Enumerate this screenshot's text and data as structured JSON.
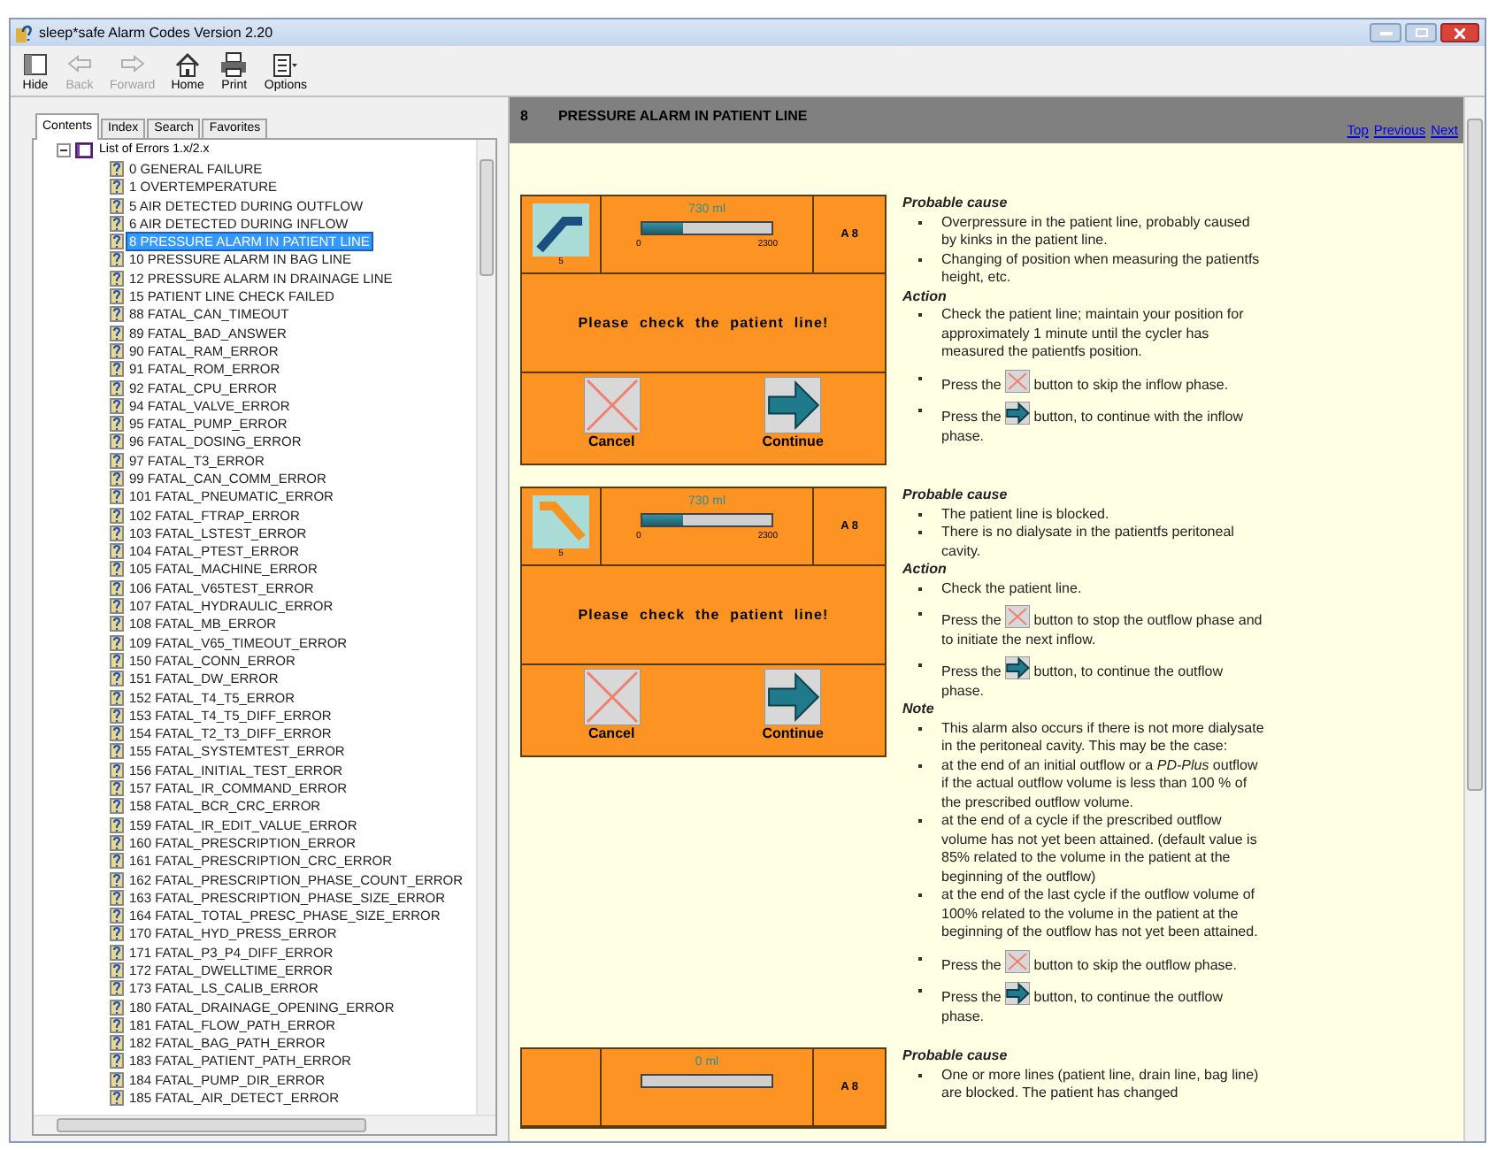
{
  "window": {
    "title": "sleep*safe Alarm Codes Version 2.20"
  },
  "toolbar": [
    {
      "label": "Hide",
      "disabled": false
    },
    {
      "label": "Back",
      "disabled": true
    },
    {
      "label": "Forward",
      "disabled": true
    },
    {
      "label": "Home",
      "disabled": false
    },
    {
      "label": "Print",
      "disabled": false
    },
    {
      "label": "Options",
      "disabled": false
    }
  ],
  "tabs": [
    {
      "label": "Contents",
      "selected": true
    },
    {
      "label": "Index",
      "selected": false
    },
    {
      "label": "Search",
      "selected": false
    },
    {
      "label": "Favorites",
      "selected": false
    }
  ],
  "tree": {
    "label": "List of Errors 1.x/2.x",
    "expanded": true,
    "children": [
      {
        "label": "0 GENERAL FAILURE",
        "selected": false
      },
      {
        "label": "1 OVERTEMPERATURE",
        "selected": false
      },
      {
        "label": "5 AIR DETECTED DURING OUTFLOW",
        "selected": false
      },
      {
        "label": "6 AIR DETECTED DURING INFLOW",
        "selected": false
      },
      {
        "label": "8 PRESSURE ALARM IN PATIENT LINE",
        "selected": true
      },
      {
        "label": "10 PRESSURE ALARM IN BAG LINE",
        "selected": false
      },
      {
        "label": "12 PRESSURE ALARM IN DRAINAGE LINE",
        "selected": false
      },
      {
        "label": "15 PATIENT LINE CHECK FAILED",
        "selected": false
      },
      {
        "label": "88 FATAL_CAN_TIMEOUT",
        "selected": false
      },
      {
        "label": "89 FATAL_BAD_ANSWER",
        "selected": false
      },
      {
        "label": "90 FATAL_RAM_ERROR",
        "selected": false
      },
      {
        "label": "91 FATAL_ROM_ERROR",
        "selected": false
      },
      {
        "label": "92 FATAL_CPU_ERROR",
        "selected": false
      },
      {
        "label": "94 FATAL_VALVE_ERROR",
        "selected": false
      },
      {
        "label": "95 FATAL_PUMP_ERROR",
        "selected": false
      },
      {
        "label": "96 FATAL_DOSING_ERROR",
        "selected": false
      },
      {
        "label": "97 FATAL_T3_ERROR",
        "selected": false
      },
      {
        "label": "99 FATAL_CAN_COMM_ERROR",
        "selected": false
      },
      {
        "label": "101 FATAL_PNEUMATIC_ERROR",
        "selected": false
      },
      {
        "label": "102 FATAL_FTRAP_ERROR",
        "selected": false
      },
      {
        "label": "103 FATAL_LSTEST_ERROR",
        "selected": false
      },
      {
        "label": "104 FATAL_PTEST_ERROR",
        "selected": false
      },
      {
        "label": "105 FATAL_MACHINE_ERROR",
        "selected": false
      },
      {
        "label": "106 FATAL_V65TEST_ERROR",
        "selected": false
      },
      {
        "label": "107 FATAL_HYDRAULIC_ERROR",
        "selected": false
      },
      {
        "label": "108 FATAL_MB_ERROR",
        "selected": false
      },
      {
        "label": "109 FATAL_V65_TIMEOUT_ERROR",
        "selected": false
      },
      {
        "label": "150 FATAL_CONN_ERROR",
        "selected": false
      },
      {
        "label": "151 FATAL_DW_ERROR",
        "selected": false
      },
      {
        "label": "152 FATAL_T4_T5_ERROR",
        "selected": false
      },
      {
        "label": "153 FATAL_T4_T5_DIFF_ERROR",
        "selected": false
      },
      {
        "label": "154 FATAL_T2_T3_DIFF_ERROR",
        "selected": false
      },
      {
        "label": "155 FATAL_SYSTEMTEST_ERROR",
        "selected": false
      },
      {
        "label": "156 FATAL_INITIAL_TEST_ERROR",
        "selected": false
      },
      {
        "label": "157 FATAL_IR_COMMAND_ERROR",
        "selected": false
      },
      {
        "label": "158 FATAL_BCR_CRC_ERROR",
        "selected": false
      },
      {
        "label": "159 FATAL_IR_EDIT_VALUE_ERROR",
        "selected": false
      },
      {
        "label": "160 FATAL_PRESCRIPTION_ERROR",
        "selected": false
      },
      {
        "label": "161 FATAL_PRESCRIPTION_CRC_ERROR",
        "selected": false
      },
      {
        "label": "162 FATAL_PRESCRIPTION_PHASE_COUNT_ERROR",
        "selected": false
      },
      {
        "label": "163 FATAL_PRESCRIPTION_PHASE_SIZE_ERROR",
        "selected": false
      },
      {
        "label": "164 FATAL_TOTAL_PRESC_PHASE_SIZE_ERROR",
        "selected": false
      },
      {
        "label": "170 FATAL_HYD_PRESS_ERROR",
        "selected": false
      },
      {
        "label": "171 FATAL_P3_P4_DIFF_ERROR",
        "selected": false
      },
      {
        "label": "172 FATAL_DWELLTIME_ERROR",
        "selected": false
      },
      {
        "label": "173 FATAL_LS_CALIB_ERROR",
        "selected": false
      },
      {
        "label": "180 FATAL_DRAINAGE_OPENING_ERROR",
        "selected": false
      },
      {
        "label": "181 FATAL_FLOW_PATH_ERROR",
        "selected": false
      },
      {
        "label": "182 FATAL_BAG_PATH_ERROR",
        "selected": false
      },
      {
        "label": "183 FATAL_PATIENT_PATH_ERROR",
        "selected": false
      },
      {
        "label": "184 FATAL_PUMP_DIR_ERROR",
        "selected": false
      },
      {
        "label": "185 FATAL_AIR_DETECT_ERROR",
        "selected": false
      }
    ]
  },
  "topic": {
    "number": "8",
    "title": "PRESSURE ALARM IN PATIENT LINE",
    "links": [
      "Top",
      "Previous",
      "Next"
    ]
  },
  "alarms": [
    {
      "screen": {
        "icon_number": "5",
        "volume": "730 ml",
        "level": 0.32,
        "scale_min": "0",
        "scale_max": "2300",
        "code": "A 8",
        "message": "Please check the patient line!",
        "buttons": [
          {
            "label": "Cancel"
          },
          {
            "label": "Continue"
          }
        ]
      },
      "sections": [
        {
          "heading": "Probable cause",
          "items": [
            {
              "kind": "text",
              "text": "Overpressure in the patient line, probably caused by kinks in the patient line."
            },
            {
              "kind": "text",
              "text": "Changing of position when measuring the patientfs height, etc."
            }
          ]
        },
        {
          "heading": "Action",
          "items": [
            {
              "kind": "text",
              "text": "Check the patient line; maintain your position for approximately 1 minute until the cycler has measured the patientfs position."
            },
            {
              "kind": "cancel-step",
              "before": "Press the",
              "after": "button to skip the inflow phase."
            },
            {
              "kind": "continue-step",
              "before": "Press the",
              "after": "button, to continue with the inflow phase."
            }
          ]
        }
      ]
    },
    {
      "screen": {
        "icon_number": "5",
        "volume": "730 ml",
        "level": 0.32,
        "scale_min": "0",
        "scale_max": "2300",
        "code": "A 8",
        "message": "Please check the patient line!",
        "buttons": [
          {
            "label": "Cancel"
          },
          {
            "label": "Continue"
          }
        ]
      },
      "sections": [
        {
          "heading": "Probable cause",
          "items": [
            {
              "kind": "text",
              "text": "The patient line is blocked."
            },
            {
              "kind": "text",
              "text": "There is no dialysate in the patientfs peritoneal cavity."
            }
          ]
        },
        {
          "heading": "Action",
          "items": [
            {
              "kind": "text",
              "text": "Check the patient line."
            },
            {
              "kind": "cancel-step",
              "before": "Press the",
              "after": "button to stop the outflow phase and to initiate the next inflow."
            },
            {
              "kind": "continue-step",
              "before": "Press the",
              "after": "button, to continue the outflow phase."
            }
          ]
        },
        {
          "heading": "Note",
          "items": [
            {
              "kind": "text",
              "text": "This alarm also occurs if there is not more dialysate in the peritoneal cavity. This may be the case:"
            },
            {
              "kind": "text",
              "text": "at the end of an initial outflow or a *PD-Plus* outflow if the actual outflow volume is less than 100 % of the prescribed outflow volume."
            },
            {
              "kind": "text",
              "text": "at the end of a cycle if the prescribed outflow volume has not yet been attained. (default value is 85% related to the volume in the patient at the beginning of the outflow)"
            },
            {
              "kind": "text",
              "text": "at the end of the last cycle if the outflow volume of 100% related to the volume in the patient at the beginning of the outflow has not yet been attained."
            },
            {
              "kind": "cancel-step",
              "before": "Press the",
              "after": "button to skip the outflow phase."
            },
            {
              "kind": "continue-step",
              "before": "Press the",
              "after": "button, to continue the outflow phase."
            }
          ]
        }
      ]
    },
    {
      "screen": {
        "volume": "0 ml",
        "level": 0,
        "code": "A 8"
      },
      "sections": [
        {
          "heading": "Probable cause",
          "items": [
            {
              "kind": "text",
              "text": "One or more lines (patient line, drain line, bag line) are blocked. The patient has changed"
            }
          ]
        }
      ]
    }
  ]
}
